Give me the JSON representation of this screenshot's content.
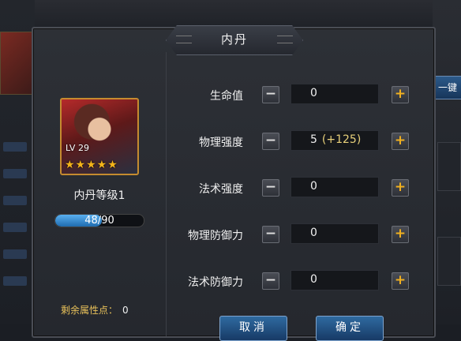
{
  "dialog": {
    "title": "内丹"
  },
  "character": {
    "level_badge": "LV 29",
    "stars": "★★★★★",
    "stars_count": 5,
    "neidan_level": "内丹等级1",
    "exp_text": "48/90",
    "exp_fraction": 0.53,
    "remaining_label": "剩余属性点：",
    "remaining_value": "0"
  },
  "stats": [
    {
      "label": "生命值",
      "value": "0",
      "bonus": ""
    },
    {
      "label": "物理强度",
      "value": "5",
      "bonus": "(+125)"
    },
    {
      "label": "法术强度",
      "value": "0",
      "bonus": ""
    },
    {
      "label": "物理防御力",
      "value": "0",
      "bonus": ""
    },
    {
      "label": "法术防御力",
      "value": "0",
      "bonus": ""
    }
  ],
  "controls": {
    "minus": "−",
    "plus": "+"
  },
  "buttons": {
    "cancel": "取消",
    "confirm": "确定"
  },
  "background": {
    "right_button": "一键"
  },
  "colors": {
    "accent_gold": "#f0b020",
    "button_blue": "#2f6aa0",
    "exp_blue": "#5ab0f0"
  }
}
